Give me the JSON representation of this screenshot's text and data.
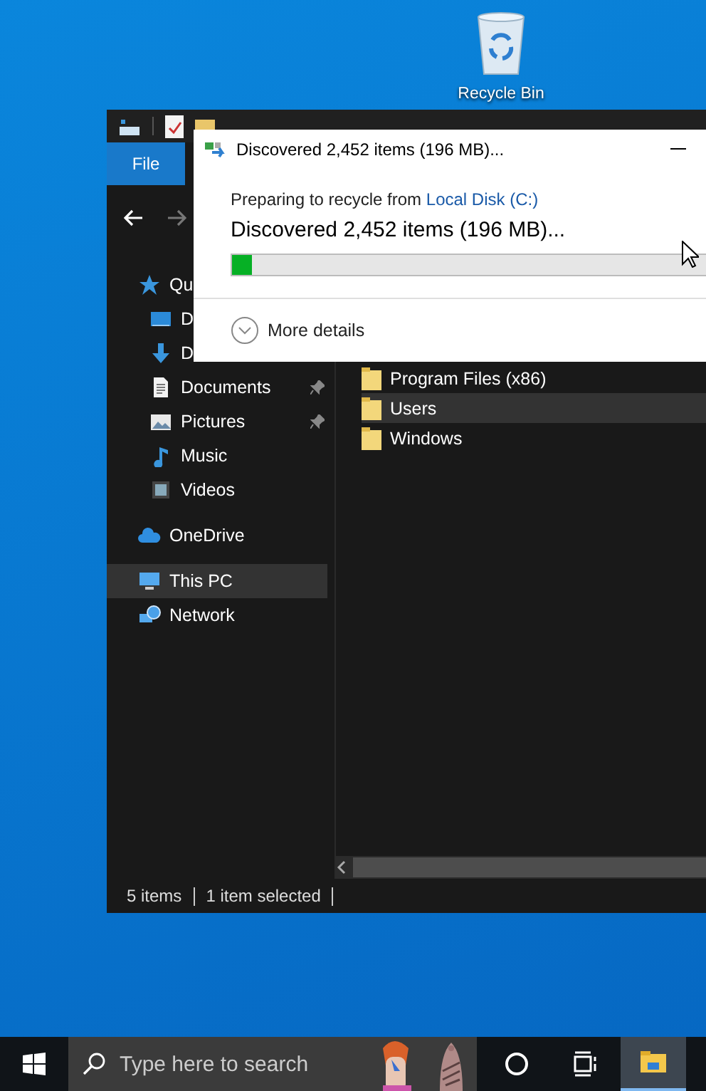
{
  "desktop_icons": [
    {
      "label": "Recycle Bin"
    }
  ],
  "explorer": {
    "ribbon_tabs": [
      {
        "label": "File",
        "selected": true
      }
    ],
    "sidebar": {
      "items": [
        {
          "label": "Qu",
          "kind": "star",
          "selected": false,
          "children": [
            {
              "label": "D",
              "kind": "desktop",
              "pinned": false,
              "selected": false
            },
            {
              "label": "D",
              "kind": "download",
              "pinned": false,
              "selected": false
            },
            {
              "label": "Documents",
              "kind": "documents",
              "pinned": true,
              "selected": false
            },
            {
              "label": "Pictures",
              "kind": "pictures",
              "pinned": true,
              "selected": false
            },
            {
              "label": "Music",
              "kind": "music",
              "pinned": false,
              "selected": false
            },
            {
              "label": "Videos",
              "kind": "videos",
              "pinned": false,
              "selected": false
            }
          ]
        },
        {
          "label": "OneDrive",
          "kind": "cloud",
          "selected": false
        },
        {
          "label": "This PC",
          "kind": "pc",
          "selected": true
        },
        {
          "label": "Network",
          "kind": "network",
          "selected": false
        }
      ]
    },
    "files": [
      {
        "name": "Program Files (x86)",
        "selected": false
      },
      {
        "name": "Users",
        "selected": true
      },
      {
        "name": "Windows",
        "selected": false
      }
    ],
    "status_bar": {
      "count": "5 items",
      "selection": "1 item selected"
    }
  },
  "dialog": {
    "title": "Discovered 2,452 items (196 MB)...",
    "message": "Preparing to recycle from ",
    "source_link": "Local Disk (C:)",
    "status": "Discovered 2,452 items (196 MB)...",
    "progress": {
      "level": 0.04
    },
    "more_details": "More details"
  },
  "taskbar": {
    "search": {
      "placeholder": "Type here to search"
    },
    "apps": [
      {
        "kind": "cortana",
        "selected": false
      },
      {
        "kind": "taskview",
        "selected": false
      },
      {
        "kind": "explorer",
        "selected": true
      }
    ]
  }
}
